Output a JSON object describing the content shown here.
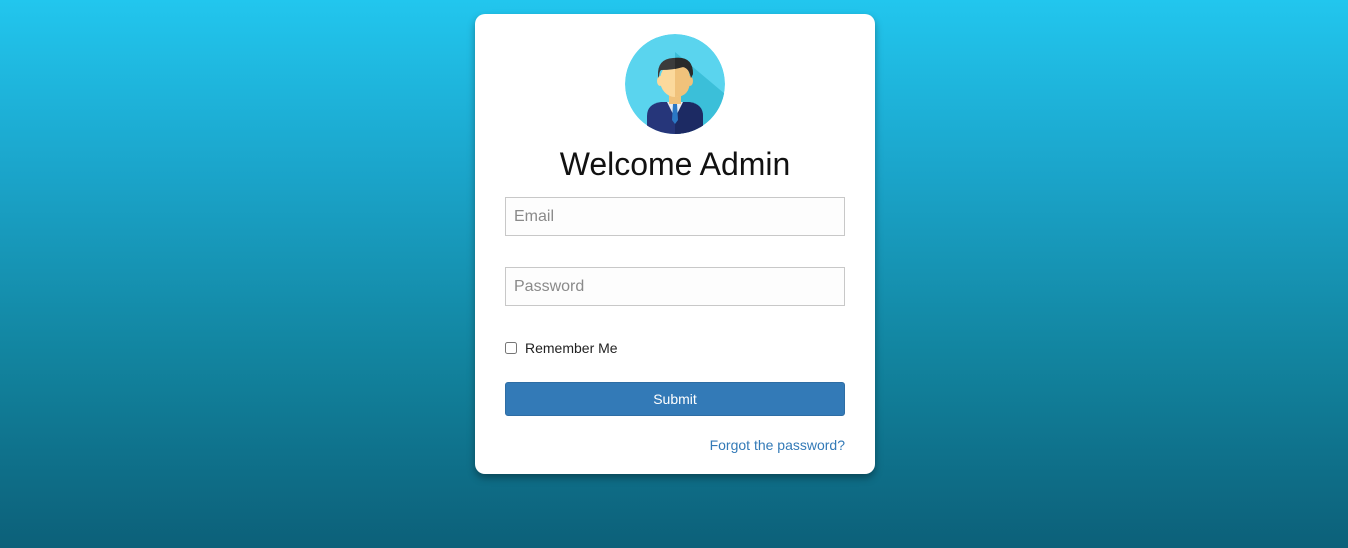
{
  "login": {
    "title": "Welcome Admin",
    "email_placeholder": "Email",
    "email_value": "",
    "password_placeholder": "Password",
    "password_value": "",
    "remember_label": "Remember Me",
    "remember_checked": false,
    "submit_label": "Submit",
    "forgot_label": "Forgot the password?"
  },
  "avatar": {
    "icon": "admin-avatar-icon"
  },
  "colors": {
    "background_top": "#22c6ee",
    "background_bottom": "#0c6079",
    "primary": "#337ab7",
    "avatar_bg": "#5ad4ee"
  }
}
